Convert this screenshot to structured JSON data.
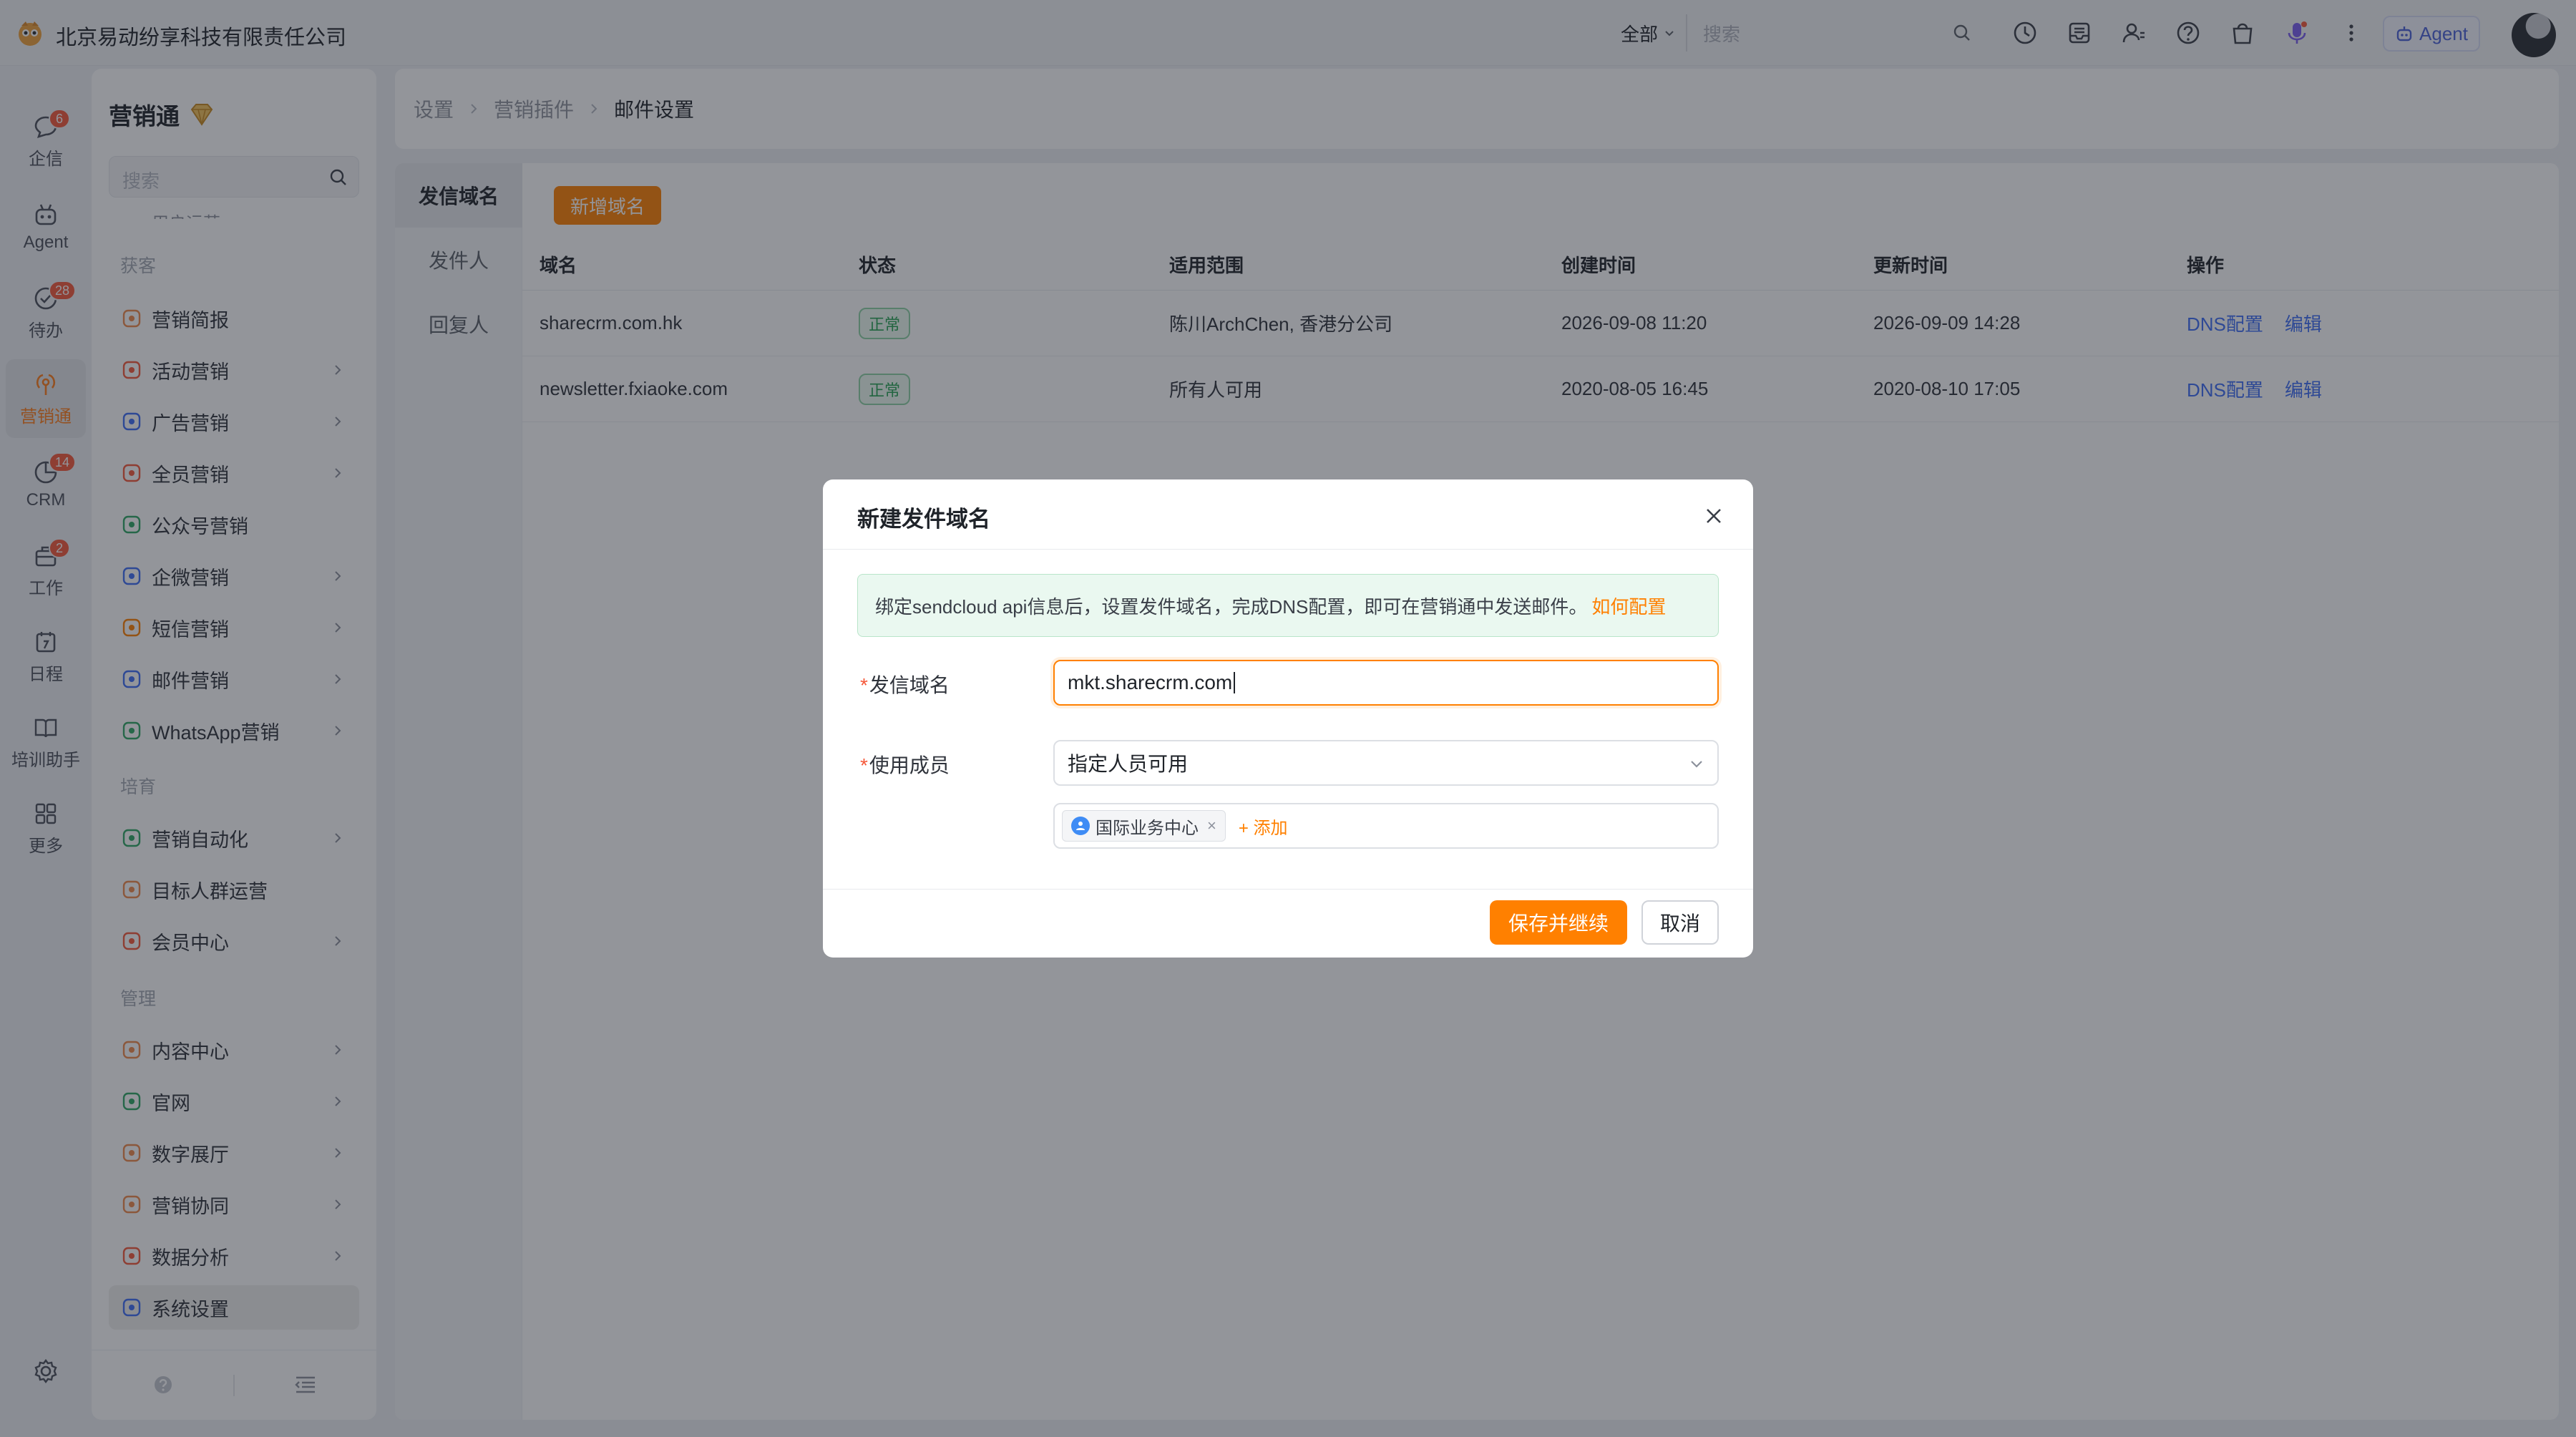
{
  "colors": {
    "accent": "#ff8000",
    "link": "#3f6df5",
    "success": "#27a454",
    "badge": "#f5593b"
  },
  "topbar": {
    "company": "北京易动纷享科技有限责任公司",
    "scope": "全部",
    "search_placeholder": "搜索",
    "agent_label": "Agent"
  },
  "rail": {
    "items": [
      {
        "label": "企信",
        "icon": "chat-icon",
        "badge": "6"
      },
      {
        "label": "Agent",
        "icon": "robot-icon",
        "badge": ""
      },
      {
        "label": "待办",
        "icon": "check-circle-icon",
        "badge": "28"
      },
      {
        "label": "营销通",
        "icon": "broadcast-icon",
        "badge": ""
      },
      {
        "label": "CRM",
        "icon": "crm-icon",
        "badge": "14"
      },
      {
        "label": "工作",
        "icon": "briefcase-icon",
        "badge": "2"
      },
      {
        "label": "日程",
        "icon": "calendar-icon",
        "badge": ""
      },
      {
        "label": "培训助手",
        "icon": "book-icon",
        "badge": ""
      },
      {
        "label": "更多",
        "icon": "grid-icon",
        "badge": ""
      }
    ]
  },
  "sidebar": {
    "title": "营销通",
    "search_placeholder": "搜索",
    "cut_item": "用户运营",
    "groups": [
      "获客",
      "培育",
      "管理"
    ],
    "items": [
      {
        "label": "营销简报",
        "icon": "chart-icon"
      },
      {
        "label": "活动营销",
        "icon": "megaphone-icon"
      },
      {
        "label": "广告营销",
        "icon": "ad-icon"
      },
      {
        "label": "全员营销",
        "icon": "people-icon"
      },
      {
        "label": "公众号营销",
        "icon": "wechat-icon"
      },
      {
        "label": "企微营销",
        "icon": "wecom-icon"
      },
      {
        "label": "短信营销",
        "icon": "sms-icon"
      },
      {
        "label": "邮件营销",
        "icon": "mail-icon"
      },
      {
        "label": "WhatsApp营销",
        "icon": "whatsapp-icon"
      },
      {
        "label": "营销自动化",
        "icon": "automation-icon"
      },
      {
        "label": "目标人群运营",
        "icon": "target-people-icon"
      },
      {
        "label": "会员中心",
        "icon": "member-icon"
      },
      {
        "label": "内容中心",
        "icon": "content-icon"
      },
      {
        "label": "官网",
        "icon": "globe-icon"
      },
      {
        "label": "数字展厅",
        "icon": "display-icon"
      },
      {
        "label": "营销协同",
        "icon": "collab-icon"
      },
      {
        "label": "数据分析",
        "icon": "analytics-icon"
      },
      {
        "label": "系统设置",
        "icon": "settings-icon"
      }
    ]
  },
  "breadcrumb": [
    "设置",
    "营销插件",
    "邮件设置"
  ],
  "subnav": [
    "发信域名",
    "发件人",
    "回复人"
  ],
  "add_domain_label": "新增域名",
  "table": {
    "headers": [
      "域名",
      "状态",
      "适用范围",
      "创建时间",
      "更新时间",
      "操作"
    ],
    "rows": [
      {
        "domain": "sharecrm.com.hk",
        "status": "正常",
        "scope": "陈川ArchChen, 香港分公司",
        "created": "2026-09-08 11:20",
        "updated": "2026-09-09 14:28",
        "dns": "DNS配置",
        "edit": "编辑"
      },
      {
        "domain": "newsletter.fxiaoke.com",
        "status": "正常",
        "scope": "所有人可用",
        "created": "2020-08-05 16:45",
        "updated": "2020-08-10 17:05",
        "dns": "DNS配置",
        "edit": "编辑"
      }
    ]
  },
  "modal": {
    "title": "新建发件域名",
    "alert_text": "绑定sendcloud api信息后，设置发件域名，完成DNS配置，即可在营销通中发送邮件。",
    "alert_link": "如何配置",
    "domain_label": "发信域名",
    "domain_value": "mkt.sharecrm.com",
    "members_label": "使用成员",
    "members_select": "指定人员可用",
    "member_tag": "国际业务中心",
    "add_member": "+ 添加",
    "save_label": "保存并继续",
    "cancel_label": "取消"
  }
}
